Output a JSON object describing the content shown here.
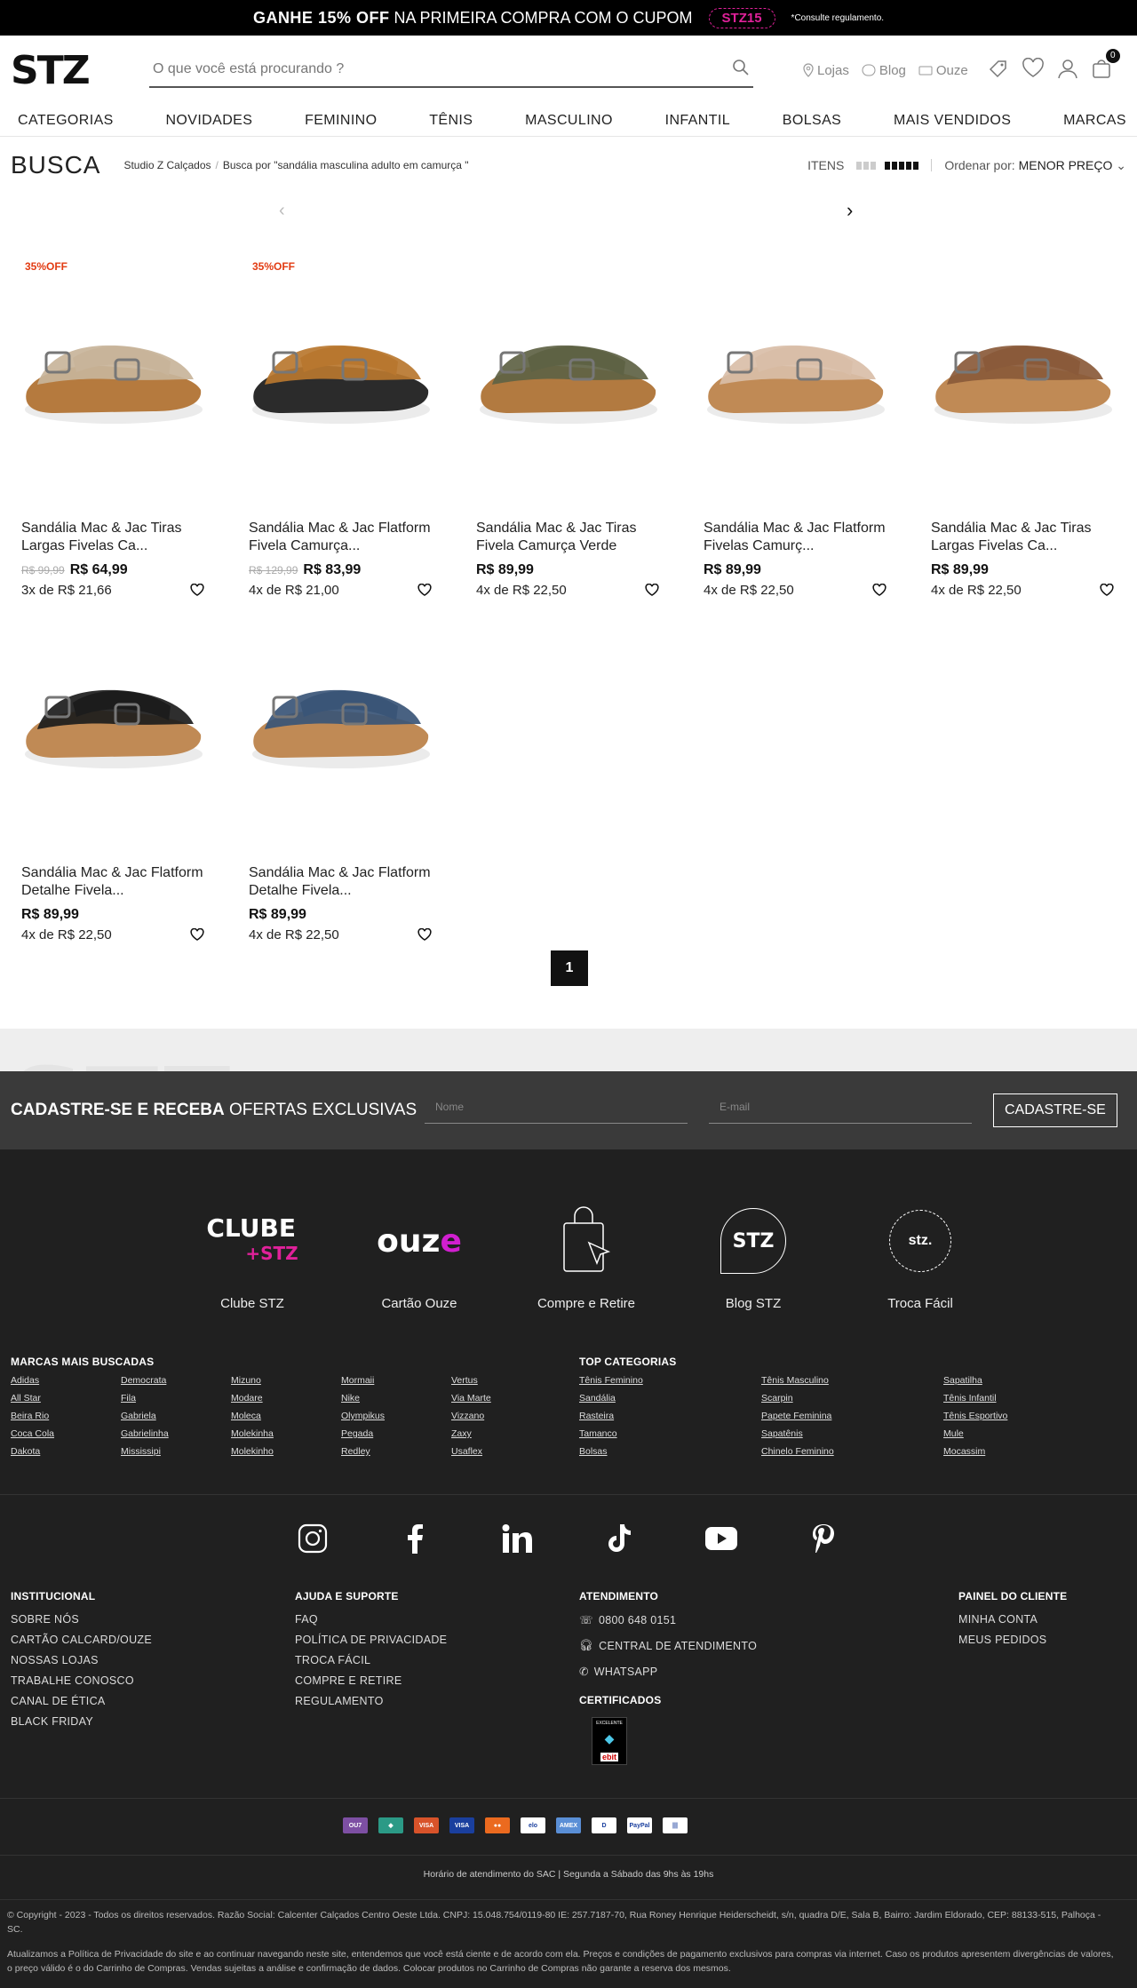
{
  "topbar": {
    "bold": "GANHE 15% OFF",
    "rest": "NA PRIMEIRA COMPRA COM O CUPOM",
    "coupon": "STZ15",
    "note": "*Consulte regulamento."
  },
  "header": {
    "logo": "STZ",
    "search_placeholder": "O que você está procurando ?",
    "links": [
      "Lojas",
      "Blog",
      "Ouze"
    ],
    "cart_count": "0"
  },
  "nav": [
    "CATEGORIAS",
    "NOVIDADES",
    "FEMININO",
    "TÊNIS",
    "MASCULINO",
    "INFANTIL",
    "BOLSAS",
    "MAIS VENDIDOS",
    "MARCAS"
  ],
  "page": {
    "title": "BUSCA",
    "breadcrumb": [
      "Studio Z Calçados",
      "Busca por \"sandália masculina adulto em camurça \""
    ],
    "itens_label": "ITENS",
    "order_label": "Ordenar por:",
    "order_value": "MENOR PREÇO"
  },
  "products": [
    {
      "badge": "35%OFF",
      "name": "Sandália Mac & Jac Tiras Largas Fivelas Ca...",
      "old": "R$ 99,99",
      "price": "R$ 64,99",
      "inst": "3x de R$ 21,66",
      "color": "#c8b49a",
      "sole": "#b57a3e"
    },
    {
      "badge": "35%OFF",
      "name": "Sandália Mac & Jac Flatform Fivela Camurça...",
      "old": "R$ 129,99",
      "price": "R$ 83,99",
      "inst": "4x de R$ 21,00",
      "color": "#b8772f",
      "sole": "#2b2b2b"
    },
    {
      "badge": "",
      "name": "Sandália Mac & Jac Tiras Fivela Camurça Verde",
      "old": "",
      "price": "R$ 89,99",
      "inst": "4x de R$ 22,50",
      "color": "#5e6244",
      "sole": "#b27a40"
    },
    {
      "badge": "",
      "name": "Sandália Mac & Jac Flatform Fivelas Camurç...",
      "old": "",
      "price": "R$ 89,99",
      "inst": "4x de R$ 22,50",
      "color": "#d9bea8",
      "sole": "#c08a55"
    },
    {
      "badge": "",
      "name": "Sandália Mac & Jac Tiras Largas Fivelas Ca...",
      "old": "",
      "price": "R$ 89,99",
      "inst": "4x de R$ 22,50",
      "color": "#8a5a3a",
      "sole": "#c08a55"
    },
    {
      "badge": "",
      "name": "Sandália Mac & Jac Flatform Detalhe Fivela...",
      "old": "",
      "price": "R$ 89,99",
      "inst": "4x de R$ 22,50",
      "color": "#1c1c1c",
      "sole": "#c08a55"
    },
    {
      "badge": "",
      "name": "Sandália Mac & Jac Flatform Detalhe Fivela...",
      "old": "",
      "price": "R$ 89,99",
      "inst": "4x de R$ 22,50",
      "color": "#3a5577",
      "sole": "#c08a55"
    }
  ],
  "pagination": {
    "current": "1"
  },
  "newsletter": {
    "bold": "CADASTRE-SE E RECEBA",
    "rest": "OFERTAS EXCLUSIVAS",
    "name_ph": "Nome",
    "email_ph": "E-mail",
    "button": "CADASTRE-SE"
  },
  "watermark": "STZ",
  "footer_blocks": [
    "Clube STZ",
    "Cartão Ouze",
    "Compre e Retire",
    "Blog STZ",
    "Troca Fácil"
  ],
  "footer_logos": {
    "clube": "CLUBE",
    "clube_stz": "+STZ",
    "ouze_a": "ouz",
    "ouze_b": "e",
    "blog": "STZ",
    "troca": "stz."
  },
  "brands_title": "MARCAS MAIS BUSCADAS",
  "brands": [
    "Adidas",
    "Democrata",
    "Mizuno",
    "Mormaii",
    "Vertus",
    "All Star",
    "Fila",
    "Modare",
    "Nike",
    "Via Marte",
    "Beira Rio",
    "Gabriela",
    "Moleca",
    "Olympikus",
    "Vizzano",
    "Coca Cola",
    "Gabrielinha",
    "Molekinha",
    "Pegada",
    "Zaxy",
    "Dakota",
    "Mississipi",
    "Molekinho",
    "Redley",
    "Usaflex"
  ],
  "cats_title": "TOP CATEGORIAS",
  "cats": [
    "Tênis Feminino",
    "Tênis Masculino",
    "Sapatilha",
    "Sandália",
    "Scarpin",
    "Tênis Infantil",
    "Rasteira",
    "Papete Feminina",
    "Tênis Esportivo",
    "Tamanco",
    "Sapatênis",
    "Mule",
    "Bolsas",
    "Chinelo Feminino",
    "Mocassim"
  ],
  "inst": {
    "title": "INSTITUCIONAL",
    "items": [
      "SOBRE NÓS",
      "CARTÃO CALCARD/OUZE",
      "NOSSAS LOJAS",
      "TRABALHE CONOSCO",
      "CANAL DE ÉTICA",
      "BLACK FRIDAY"
    ]
  },
  "ajuda": {
    "title": "AJUDA E SUPORTE",
    "items": [
      "FAQ",
      "POLÍTICA DE PRIVACIDADE",
      "TROCA FÁCIL",
      "COMPRE E RETIRE",
      "REGULAMENTO"
    ]
  },
  "atend": {
    "title": "ATENDIMENTO",
    "items": [
      "0800 648 0151",
      "CENTRAL DE ATENDIMENTO",
      "WHATSAPP"
    ],
    "cert_title": "CERTIFICADOS",
    "cert_a": "EXCELENTE",
    "cert_b": "ebit"
  },
  "painel": {
    "title": "PAINEL DO CLIENTE",
    "items": [
      "MINHA CONTA",
      "MEUS PEDIDOS"
    ]
  },
  "payments": [
    {
      "l": "OU7",
      "c": "#7d4fa3"
    },
    {
      "l": "◆",
      "c": "#2b9a86"
    },
    {
      "l": "VISA",
      "c": "#d8532a"
    },
    {
      "l": "VISA",
      "c": "#1a3f9e"
    },
    {
      "l": "●●",
      "c": "#eb6a1f"
    },
    {
      "l": "elo",
      "c": "#ffffff"
    },
    {
      "l": "AMEX",
      "c": "#5a8fd6"
    },
    {
      "l": "D",
      "c": "#ffffff"
    },
    {
      "l": "PayPal",
      "c": "#ffffff"
    },
    {
      "l": "|||",
      "c": "#ffffff"
    }
  ],
  "sac": "Horário de atendimento do SAC | Segunda a Sábado das 9hs às 19hs",
  "copyright": "© Copyright - 2023 - Todos os direitos reservados. Razão Social: Calcenter Calçados Centro Oeste Ltda. CNPJ: 15.048.754/0119-80 IE: 257.7187-70, Rua Roney Henrique Heiderscheidt, s/n, quadra D/E, Sala B, Bairro: Jardim Eldorado, CEP: 88133-515, Palhoça - SC.",
  "policy": "Atualizamos a Política de Privacidade do site e ao continuar navegando neste site, entendemos que você está ciente e de acordo com ela. Preços e condições de pagamento exclusivos para compras via internet. Caso os produtos apresentem divergências de valores, o preço válido é o do Carrinho de Compras. Vendas sujeitas a análise e confirmação de dados. Colocar produtos no Carrinho de Compras não garante a reserva dos mesmos."
}
